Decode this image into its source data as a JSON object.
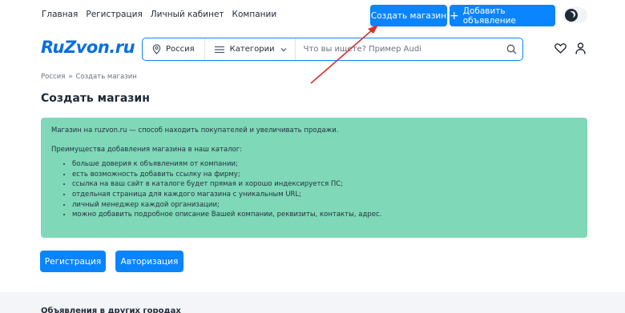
{
  "topnav": {
    "items": [
      "Главная",
      "Регистрация",
      "Личный кабинет",
      "Компании"
    ]
  },
  "header": {
    "create_store": "Создать магазин",
    "add_ad": "Добавить объявление",
    "add_icon": "plus-icon",
    "theme_toggle_icon": "moon-icon"
  },
  "logo": "RuZvon.ru",
  "search": {
    "region": "Россия",
    "categories": "Категории",
    "placeholder": "Что вы ищете? Пример Audi"
  },
  "breadcrumb": {
    "root": "Россия",
    "separator": "»",
    "current": "Создать магазин"
  },
  "page": {
    "title": "Создать магазин"
  },
  "info": {
    "intro": "Магазин на ruzvon.ru — способ находить покупателей и увеличивать продажи.",
    "benefits_title": "Преимущества добавления магазина в наш каталог:",
    "benefits": [
      "больше доверия к объявлениям от компании;",
      "есть возможность добавить ссылку на фирму;",
      "ссылка на ваш сайт в каталоге будет прямая и хорошо индексируется ПС;",
      "отдельная страница для каждого магазина с уникальным URL;",
      "личный менеджер каждой организации;",
      "можно добавить подробное описание Вашей компании, реквизиты, контакты, адрес."
    ]
  },
  "actions": {
    "register": "Регистрация",
    "login": "Авторизация"
  },
  "footer": {
    "title": "Объявления в других городах"
  },
  "colors": {
    "accent": "#0a84ff",
    "logo": "#0a6ee0",
    "info_bg": "#7fd8b8",
    "arrow": "#d9302e"
  }
}
